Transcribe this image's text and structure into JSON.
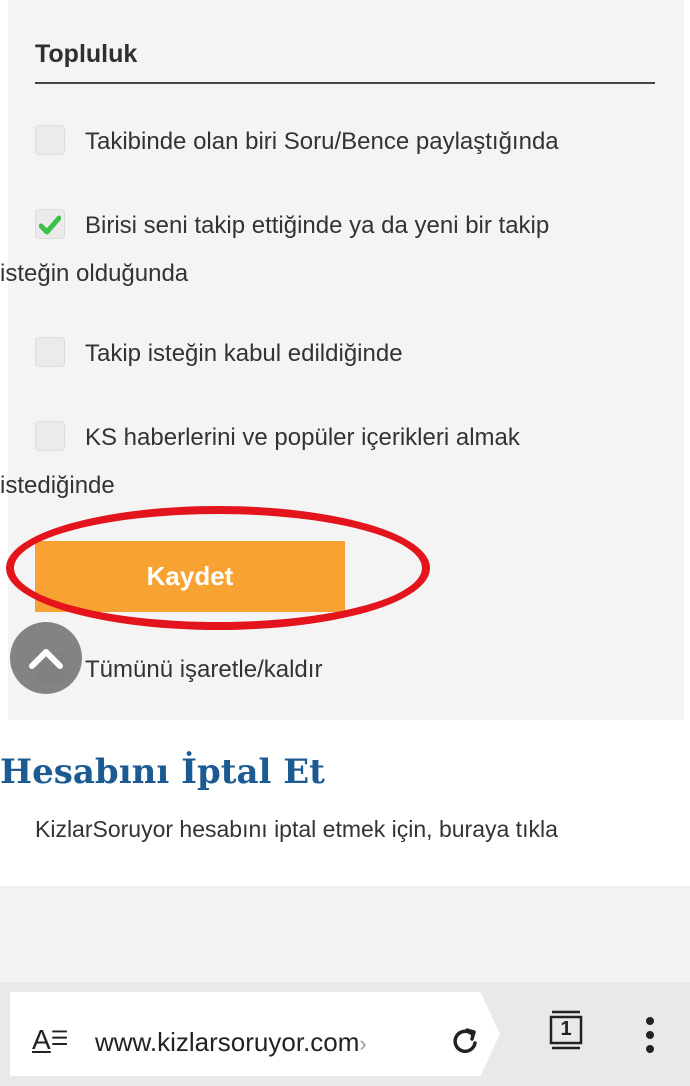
{
  "community": {
    "title": "Topluluk",
    "options": [
      {
        "label": "Takibinde olan biri Soru/Bence paylaştığında",
        "checked": false
      },
      {
        "label_line1": "Birisi seni takip ettiğinde ya da yeni bir takip",
        "label_line2": "isteğin olduğunda",
        "checked": true
      },
      {
        "label": "Takip isteğin kabul edildiğinde",
        "checked": false
      },
      {
        "label_line1": "KS haberlerini ve popüler içerikleri almak",
        "label_line2": "istediğinde",
        "checked": false
      }
    ],
    "save_label": "Kaydet",
    "toggle_all_label": "Tümünü işaretle/kaldır"
  },
  "cancel_account": {
    "title": "Hesabını İptal Et",
    "description": "KizlarSoruyor hesabını iptal etmek için, buraya tıkla"
  },
  "browser": {
    "url": "www.kizlarsoruyor.com",
    "url_chevron": "›",
    "tab_count": "1",
    "reader_icon_a": "A",
    "reader_icon_lines": "☰"
  },
  "colors": {
    "accent_orange": "#f7a232",
    "highlight_red": "#e3141b",
    "link_blue": "#1c5a92",
    "check_green": "#3cc24a"
  }
}
